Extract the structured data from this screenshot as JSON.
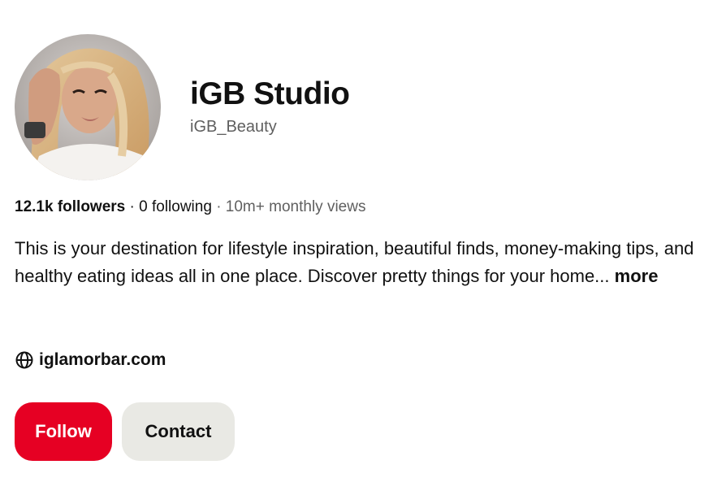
{
  "profile": {
    "name": "iGB Studio",
    "username": "iGB_Beauty",
    "avatar_alt": "profile photo"
  },
  "stats": {
    "followers": "12.1k followers",
    "separator": "·",
    "following": "0 following",
    "views": "10m+ monthly views"
  },
  "bio": {
    "text": "This is your destination for lifestyle inspiration, beautiful finds, money-making tips, and healthy eating ideas all in one place. Discover pretty things for your home...",
    "more_label": "more"
  },
  "website": {
    "icon": "globe-icon",
    "label": "iglamorbar.com"
  },
  "actions": {
    "follow_label": "Follow",
    "contact_label": "Contact"
  },
  "colors": {
    "follow_bg": "#e60023",
    "contact_bg": "#e9e9e4",
    "muted_text": "#5f5f5f"
  }
}
